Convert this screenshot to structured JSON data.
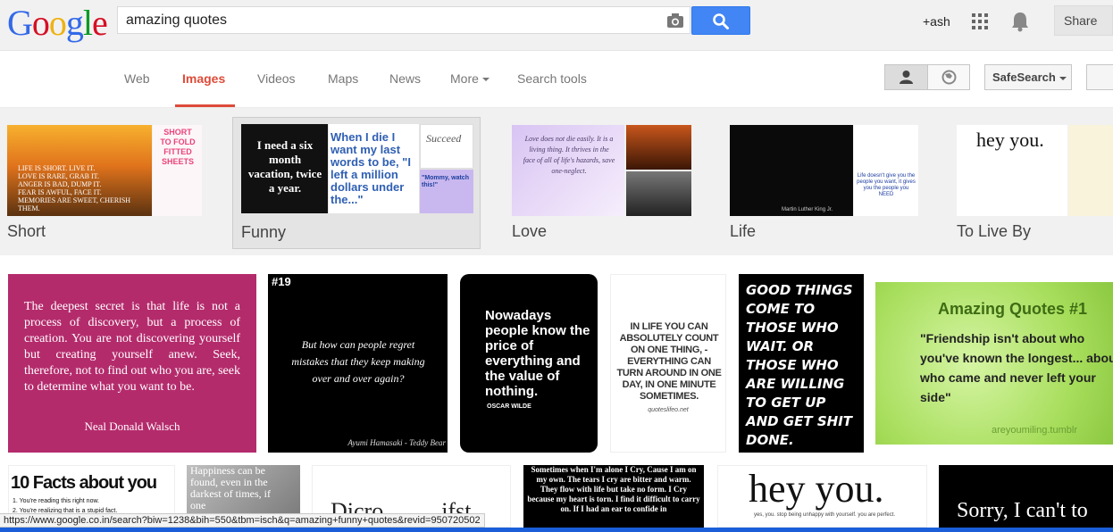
{
  "header": {
    "logo_letters": [
      {
        "ch": "G",
        "color": "#3369e8"
      },
      {
        "ch": "o",
        "color": "#d50f25"
      },
      {
        "ch": "o",
        "color": "#eeb211"
      },
      {
        "ch": "g",
        "color": "#3369e8"
      },
      {
        "ch": "l",
        "color": "#009925"
      },
      {
        "ch": "e",
        "color": "#d50f25"
      }
    ],
    "query": "amazing quotes",
    "user": "+ash",
    "share_label": "Share",
    "icons": [
      "camera-icon",
      "search-icon",
      "apps-grid-icon",
      "bell-icon"
    ]
  },
  "nav": {
    "tabs": [
      "Web",
      "Images",
      "Videos",
      "Maps",
      "News",
      "More",
      "Search tools"
    ],
    "active_tab": "Images",
    "safesearch_label": "SafeSearch",
    "accent_color": "#dd4b39"
  },
  "categories": [
    {
      "label": "Short",
      "tiles": [
        {
          "text": "LIFE IS SHORT. LIVE IT.\nLOVE IS RARE, GRAB IT.\nANGER IS BAD, DUMP IT.\nFEAR IS AWFUL, FACE IT.\nMEMORIES ARE SWEET, CHERISH THEM."
        },
        {
          "text": "SHORT\nTO FOLD\nFITTED\nSHEETS"
        }
      ]
    },
    {
      "label": "Funny",
      "tiles": [
        {
          "text": "I need a six month vacation, twice a year."
        },
        {
          "text": "When I die I want my last words to be, \"I left a million dollars under the...\""
        },
        {
          "text": "Succeed"
        },
        {
          "text": "\"Mommy, watch this!\""
        }
      ]
    },
    {
      "label": "Love",
      "tiles": [
        {
          "text": "Love does not die easily. It is a living thing. It thrives in the face of all of life's hazards, save one-neglect."
        },
        {
          "text": ""
        },
        {
          "text": ""
        }
      ]
    },
    {
      "label": "Life",
      "tiles": [
        {
          "text": "Martin Luther King Jr."
        },
        {
          "text": "Life doesn't give you the people you want, it gives you the people you NEED"
        }
      ]
    },
    {
      "label": "To Live By",
      "tiles": [
        {
          "text": "hey you."
        },
        {
          "text": ""
        }
      ]
    }
  ],
  "results": [
    {
      "text": "The deepest secret is that life is not a process of discovery, but a process of creation. You are not discovering yourself but creating yourself anew. Seek, therefore, not to find out who you are, seek to determine what you want to be.",
      "author": "Neal Donald Walsch"
    },
    {
      "tag": "#19",
      "text": "But how can people regret mistakes that they keep making over and over again?",
      "author": "Ayumi Hamasaki - Teddy Bear"
    },
    {
      "text": "Nowadays people know the price of everything and the value of nothing.",
      "author": "OSCAR WILDE"
    },
    {
      "text": "IN LIFE YOU CAN ABSOLUTELY COUNT ON ONE THING, - EVERYTHING CAN TURN AROUND IN ONE DAY, IN ONE MINUTE SOMETIMES.",
      "author": "quoteslifeo.net"
    },
    {
      "text": "GOOD THINGS COME TO THOSE WHO WAIT. OR THOSE WHO ARE WILLING TO GET UP AND GET SHIT DONE."
    },
    {
      "title": "Amazing Quotes #1",
      "text": "\"Friendship isn't about who you've known the longest... about who came and never left your side\"",
      "author": "areyoumiling.tumblr"
    },
    {
      "title": "10 Facts about you",
      "text": "1. You're reading this right now.\n2. You're realizing that is a stupid fact."
    },
    {
      "text": "Happiness can be found, even in the darkest of times, if one"
    },
    {
      "text": "Dicro..........ifst"
    },
    {
      "text": "Sometimes when I'm alone I Cry, Cause I am on my own. The tears I cry are bitter and warm. They flow with life but take no form. I Cry because my heart is torn. I find it difficult to carry on. If I had an ear to confide in"
    },
    {
      "text": "hey you.",
      "sub": "yes, you. stop being unhappy with yourself. you are perfect."
    },
    {
      "text": "Sorry, I can't to"
    }
  ],
  "status_url": "https://www.google.co.in/search?biw=1238&bih=550&tbm=isch&q=amazing+funny+quotes&revid=950720502"
}
